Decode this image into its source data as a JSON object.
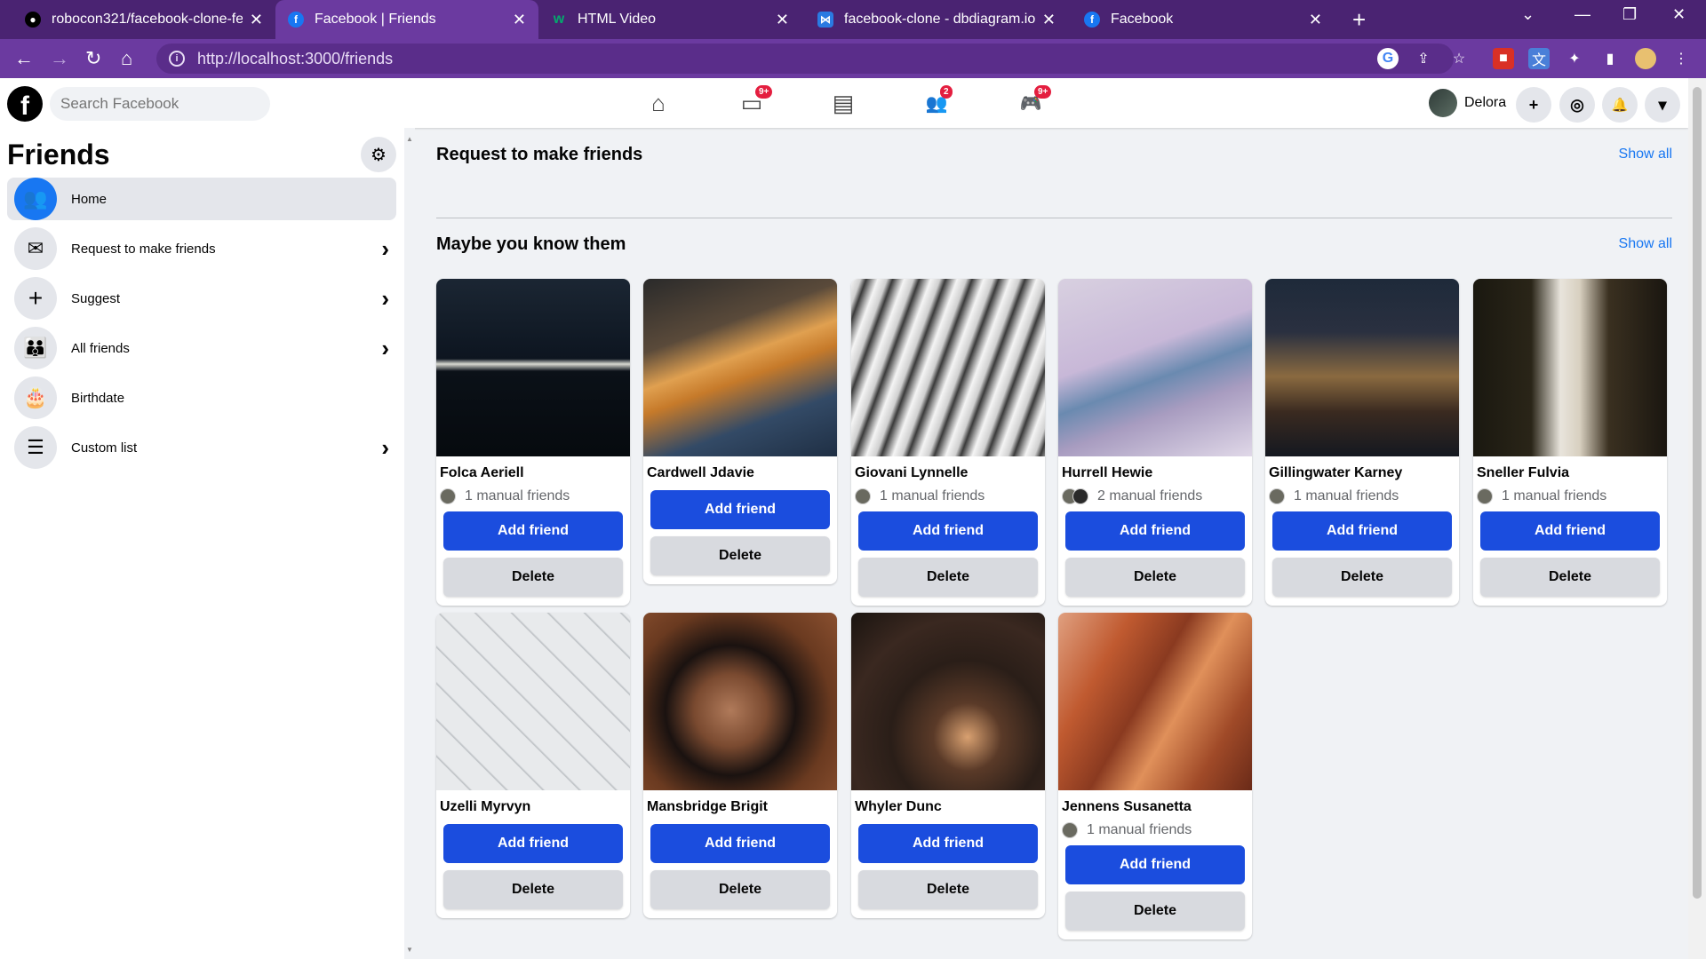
{
  "browser": {
    "tabs": [
      {
        "title": "robocon321/facebook-clone-fe",
        "icon": "github-icon"
      },
      {
        "title": "Facebook | Friends",
        "icon": "facebook-icon"
      },
      {
        "title": "HTML Video",
        "icon": "w3schools-icon"
      },
      {
        "title": "facebook-clone - dbdiagram.io",
        "icon": "dbdiagram-icon"
      },
      {
        "title": "Facebook",
        "icon": "facebook-icon"
      }
    ],
    "url": "http://localhost:3000/friends"
  },
  "header": {
    "logo": "f",
    "search_placeholder": "Search Facebook",
    "nav": [
      {
        "icon": "home-icon",
        "glyph": "⌂",
        "badge": ""
      },
      {
        "icon": "watch-icon",
        "glyph": "▭",
        "badge": "9+"
      },
      {
        "icon": "marketplace-icon",
        "glyph": "▤",
        "badge": ""
      },
      {
        "icon": "groups-icon",
        "glyph": "👥",
        "badge": "2"
      },
      {
        "icon": "gaming-icon",
        "glyph": "🎮",
        "badge": "9+"
      }
    ],
    "user_name": "Delora",
    "actions": [
      "+",
      "◎",
      "🔔",
      "▾"
    ]
  },
  "sidebar": {
    "title": "Friends",
    "items": [
      {
        "label": "Home",
        "icon": "friends-home-icon",
        "glyph": "👥",
        "chevron": false
      },
      {
        "label": "Request to make friends",
        "icon": "envelope-icon",
        "glyph": "✉",
        "chevron": true
      },
      {
        "label": "Suggest",
        "icon": "plus-icon",
        "glyph": "+",
        "chevron": true
      },
      {
        "label": "All friends",
        "icon": "all-friends-icon",
        "glyph": "👪",
        "chevron": true
      },
      {
        "label": "Birthdate",
        "icon": "cake-icon",
        "glyph": "🎂",
        "chevron": false
      },
      {
        "label": "Custom list",
        "icon": "sliders-icon",
        "glyph": "☰",
        "chevron": true
      }
    ]
  },
  "main": {
    "requests": {
      "title": "Request to make friends",
      "show_all": "Show all"
    },
    "suggestions": {
      "title": "Maybe you know them",
      "show_all": "Show all",
      "add_label": "Add friend",
      "delete_label": "Delete",
      "people": [
        {
          "name": "Folca Aeriell",
          "mutual": "1 manual friends",
          "mutual_count": 1,
          "photo": "linear-gradient(180deg,#1b2633 0%,#0d1520 45%,#d8d8d0 48%,#0b1118 52%,#060a0e 100%)"
        },
        {
          "name": "Cardwell Jdavie",
          "mutual": "",
          "mutual_count": 0,
          "photo": "linear-gradient(160deg,#2a2a2a 0%,#5a4a3a 30%,#e0a050 45%,#c67a2a 55%,#334a66 75%,#1f2f44 100%)"
        },
        {
          "name": "Giovani Lynnelle",
          "mutual": "1 manual friends",
          "mutual_count": 1,
          "photo": "repeating-linear-gradient(110deg,#f5f5f5 0px,#d0d0d0 10px,#3a3a3a 16px,#9a9a9a 22px,#f0f0f0 28px)"
        },
        {
          "name": "Hurrell Hewie",
          "mutual": "2 manual friends",
          "mutual_count": 2,
          "photo": "linear-gradient(160deg,#d8d0e0 0%,#c8b8d8 40%,#6a8ab0 55%,#a89cc0 70%,#e0d8e8 100%)"
        },
        {
          "name": "Gillingwater Karney",
          "mutual": "1 manual friends",
          "mutual_count": 1,
          "photo": "linear-gradient(180deg,#1e2a3a 0%,#2a3040 30%,#8a6a40 55%,#3a2a20 75%,#141820 100%)"
        },
        {
          "name": "Sneller Fulvia",
          "mutual": "1 manual friends",
          "mutual_count": 1,
          "photo": "linear-gradient(90deg,#1a1810 0%,#2a2518 30%,#e8e4dc 45%,#d8d0c0 55%,#3a3020 70%,#1a1610 100%)"
        },
        {
          "name": "Uzelli Myrvyn",
          "mutual": "",
          "mutual_count": 0,
          "photo": "repeating-linear-gradient(45deg,#e8eaec 0px,#e8eaec 26px,#b8bcc0 27px,#e8eaec 29px),linear-gradient(#ddd,#ddd)"
        },
        {
          "name": "Mansbridge Brigit",
          "mutual": "",
          "mutual_count": 0,
          "photo": "radial-gradient(circle at 45% 55%,#b07a5a 0%,#7a4a30 25%,#1a1210 45%,#6a3a20 70%,#8a5030 100%)"
        },
        {
          "name": "Whyler Dunc",
          "mutual": "",
          "mutual_count": 0,
          "photo": "radial-gradient(circle at 60% 70%,#d8a070 0%,#5a3a28 20%,#2a1e18 45%,#3a2820 70%,#1a1410 100%)"
        },
        {
          "name": "Jennens Susanetta",
          "mutual": "1 manual friends",
          "mutual_count": 1,
          "photo": "linear-gradient(120deg,#e0a080 0%,#c05a30 25%,#8a3a20 45%,#e0905a 60%,#a04a28 80%,#6a2a18 100%)"
        }
      ]
    }
  },
  "colors": {
    "brand_blue": "#1b4dde",
    "link_blue": "#1877f2",
    "chrome_purple": "#6b3aa0",
    "badge_red": "#e41e3f"
  }
}
